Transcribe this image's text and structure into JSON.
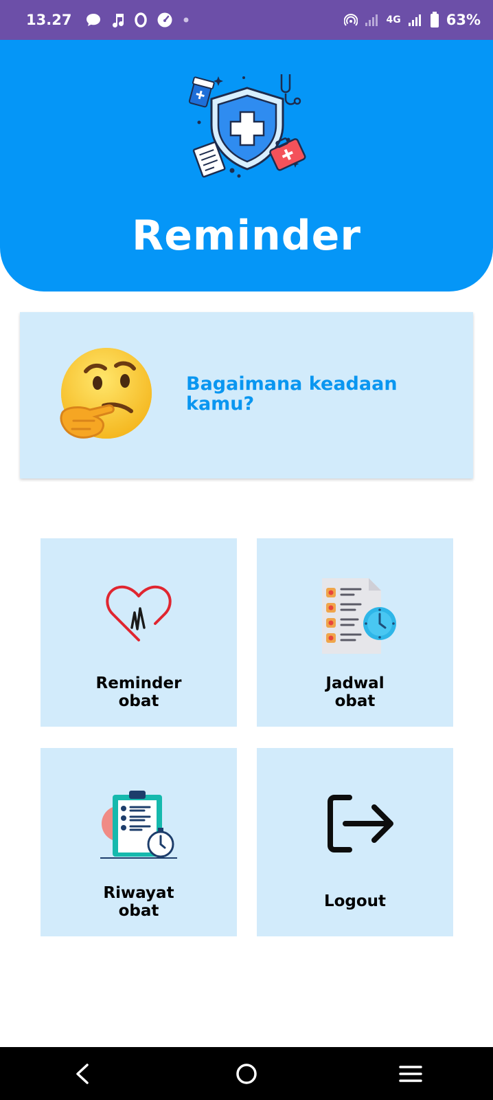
{
  "status_bar": {
    "time": "13.27",
    "network": "4G",
    "battery": "63%",
    "icons": [
      "chat-icon",
      "music-note-icon",
      "opera-icon",
      "speedometer-icon",
      "dot-icon",
      "hotspot-icon",
      "signal-icon",
      "battery-icon"
    ]
  },
  "header": {
    "title": "Reminder",
    "logo_icon": "health-shield-icon",
    "background_color": "#0596f7"
  },
  "mood_card": {
    "question": "Bagaimana keadaan kamu?",
    "emoji": "thinking-face-icon",
    "text_color": "#0a96f0"
  },
  "menu": {
    "items": [
      {
        "id": "reminder",
        "line1": "Reminder",
        "line2": "obat",
        "icon": "heart-pulse-icon"
      },
      {
        "id": "jadwal",
        "line1": "Jadwal",
        "line2": "obat",
        "icon": "schedule-list-icon"
      },
      {
        "id": "riwayat",
        "line1": "Riwayat",
        "line2": "obat",
        "icon": "clipboard-history-icon"
      },
      {
        "id": "logout",
        "line1": "Logout",
        "line2": "",
        "icon": "logout-icon"
      }
    ],
    "tile_color": "#d2ebfb"
  },
  "nav_bar": {
    "buttons": [
      "back-icon",
      "home-icon",
      "menu-icon"
    ]
  }
}
